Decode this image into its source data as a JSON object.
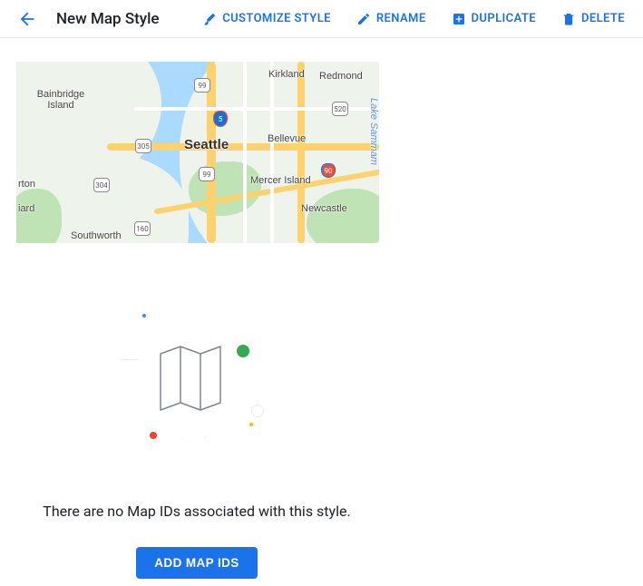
{
  "header": {
    "title": "New Map Style",
    "actions": {
      "customize": "Customize Style",
      "rename": "Rename",
      "duplicate": "Duplicate",
      "delete": "Delete"
    }
  },
  "map": {
    "cities": {
      "seattle": "Seattle",
      "bellevue": "Bellevue",
      "kirkland": "Kirkland",
      "redmond": "Redmond",
      "bainbridge": "Bainbridge Island",
      "mercer": "Mercer Island",
      "newcastle": "Newcastle",
      "southworth": "Southworth",
      "rton": "rton",
      "iard": "iard"
    },
    "routes": {
      "r99a": "99",
      "r99b": "99",
      "r520": "520",
      "r305": "305",
      "r304": "304",
      "r160": "160",
      "i5": "5",
      "i90": "90"
    },
    "water": "Lake Sammam"
  },
  "empty_state": {
    "message": "There are no Map IDs associated with this style.",
    "cta": "Add Map IDs"
  }
}
